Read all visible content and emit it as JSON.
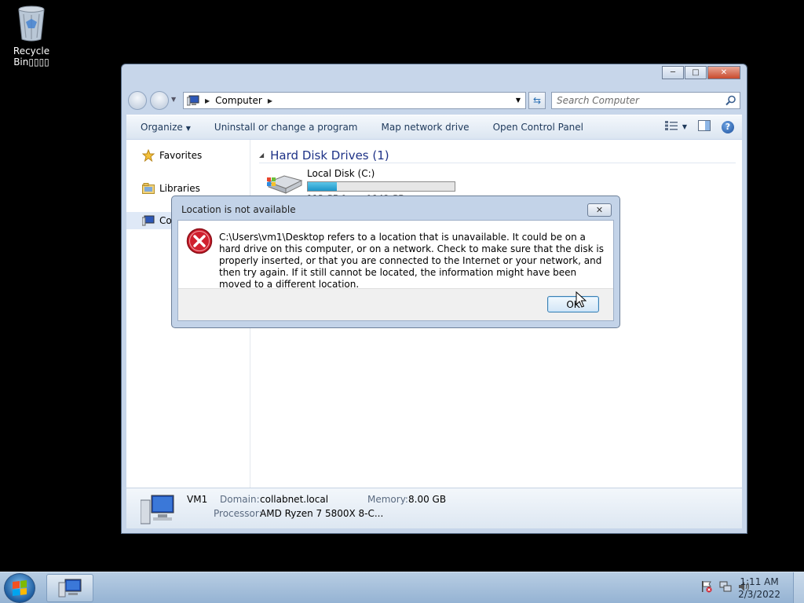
{
  "desktop": {
    "recycle_bin_label_line1": "Recycle",
    "recycle_bin_label_line2": "Bin▯▯▯▯"
  },
  "explorer": {
    "address_crumb": "Computer",
    "search_placeholder": "Search Computer",
    "toolbar": {
      "organize": "Organize",
      "uninstall": "Uninstall or change a program",
      "map_drive": "Map network drive",
      "control_panel": "Open Control Panel"
    },
    "nav": {
      "favorites": "Favorites",
      "libraries": "Libraries",
      "computer": "Co"
    },
    "group_header": "Hard Disk Drives (1)",
    "drive": {
      "name": "Local Disk (C:)",
      "used_fraction": 0.2,
      "free_text": "113 GB free of 149 GB"
    },
    "details": {
      "name": "VM1",
      "domain_label": "Domain:",
      "domain_value": "collabnet.local",
      "memory_label": "Memory:",
      "memory_value": "8.00 GB",
      "processor_label": "Processor:",
      "processor_value": "AMD Ryzen 7 5800X 8-C..."
    }
  },
  "dialog": {
    "title": "Location is not available",
    "message": "C:\\Users\\vm1\\Desktop refers to a location that is unavailable. It could be on a hard drive on this computer, or on a network. Check to make sure that the disk is properly inserted, or that you are connected to the Internet or your network, and then try again. If it still cannot be located, the information might have been moved to a different location.",
    "ok_label": "OK"
  },
  "taskbar": {
    "time": "1:11 AM",
    "date": "2/3/2022"
  },
  "colors": {
    "desktop": "#000000",
    "window_frame": "#c7d6ea",
    "accent_blue": "#1e3287",
    "error_red": "#d0202e"
  }
}
